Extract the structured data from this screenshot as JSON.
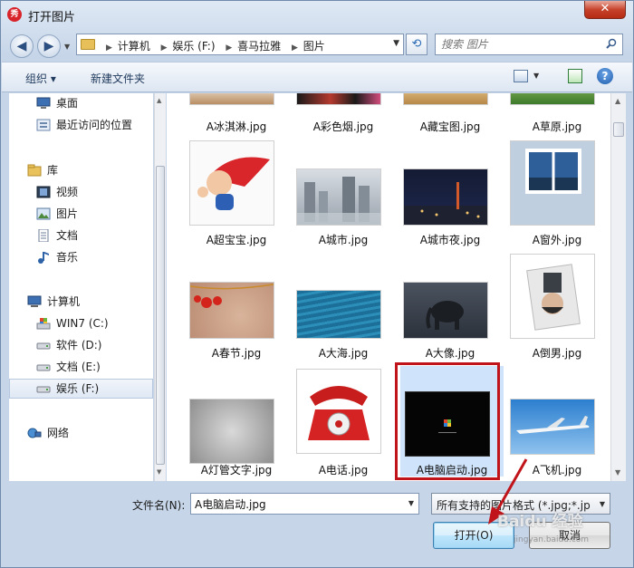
{
  "window": {
    "title": "打开图片",
    "app_icon_text": "秀"
  },
  "address": {
    "crumbs": [
      "计算机",
      "娱乐 (F:)",
      "喜马拉雅",
      "图片"
    ]
  },
  "search": {
    "placeholder": "搜索 图片"
  },
  "toolbar": {
    "organize": "组织 ▾",
    "new_folder": "新建文件夹"
  },
  "nav": {
    "items": [
      {
        "label": "桌面",
        "icon": "desktop-icon"
      },
      {
        "label": "最近访问的位置",
        "icon": "recent-icon"
      },
      {
        "label": "库",
        "icon": "library-icon"
      },
      {
        "label": "视频",
        "icon": "video-icon"
      },
      {
        "label": "图片",
        "icon": "pictures-icon"
      },
      {
        "label": "文档",
        "icon": "documents-icon"
      },
      {
        "label": "音乐",
        "icon": "music-icon"
      },
      {
        "label": "计算机",
        "icon": "computer-icon"
      },
      {
        "label": "WIN7 (C:)",
        "icon": "drive-icon"
      },
      {
        "label": "软件 (D:)",
        "icon": "drive-icon"
      },
      {
        "label": "文档 (E:)",
        "icon": "drive-icon"
      },
      {
        "label": "娱乐 (F:)",
        "icon": "drive-icon"
      },
      {
        "label": "网络",
        "icon": "network-icon"
      }
    ],
    "selected": "娱乐 (F:)"
  },
  "files": [
    "A冰淇淋.jpg",
    "A彩色烟.jpg",
    "A藏宝图.jpg",
    "A草原.jpg",
    "A超宝宝.jpg",
    "A城市.jpg",
    "A城市夜.jpg",
    "A窗外.jpg",
    "A春节.jpg",
    "A大海.jpg",
    "A大像.jpg",
    "A倒男.jpg",
    "A灯管文字.jpg",
    "A电话.jpg",
    "A电脑启动.jpg",
    "A飞机.jpg"
  ],
  "selected_file": "A电脑启动.jpg",
  "bottom": {
    "filename_label": "文件名(N):",
    "filename_value": "A电脑启动.jpg",
    "filetype_value": "所有支持的图片格式 (*.jpg;*.jp",
    "open_label": "打开(O)",
    "cancel_label": "取消"
  },
  "watermark": {
    "text": "Baidu 经验",
    "sub": "jingyan.baidu.com"
  },
  "colors": {
    "highlight_box": "#c0141a",
    "selection": "#cfe3fb",
    "window_chrome": "#c6d5e8"
  }
}
